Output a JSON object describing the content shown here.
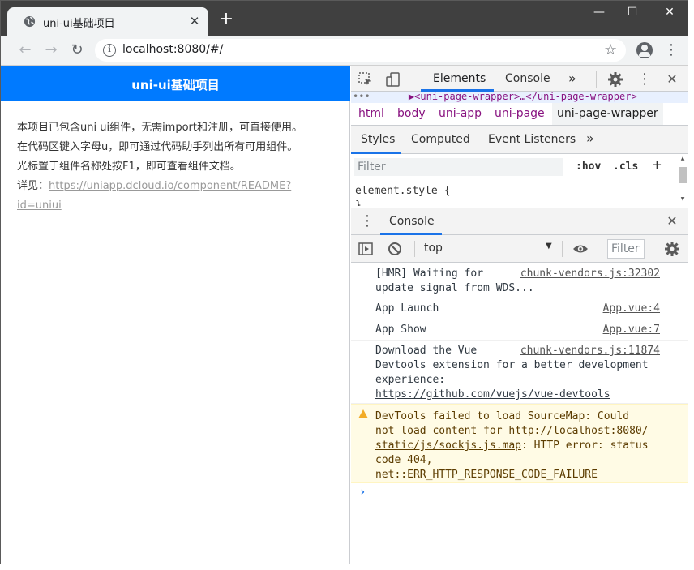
{
  "browser": {
    "tab_title": "uni-ui基础项目",
    "tab_close": "✕",
    "new_tab": "+",
    "url": "localhost:8080/#/",
    "window_controls": {
      "minimize": "—",
      "maximize": "☐",
      "close": "✕"
    },
    "nav": {
      "back": "←",
      "forward": "→",
      "reload": "↻",
      "star": "☆",
      "menu": "⋮"
    }
  },
  "app": {
    "navbar_title": "uni-ui基础项目",
    "lines": [
      "本项目已包含uni ui组件，无需import和注册，可直接使用。",
      "在代码区键入字母u，即可通过代码助手列出所有可用组件。",
      "光标置于组件名称处按F1，即可查看组件文档。"
    ],
    "detail_prefix": "详见：",
    "detail_link_line1": "https://uniapp.dcloud.io/component/README?",
    "detail_link_line2": "id=uniui"
  },
  "devtools": {
    "tabs": [
      "Elements",
      "Console"
    ],
    "more": "»",
    "close": "✕",
    "dom_line": "▶<uni-page-wrapper>…</uni-page-wrapper>",
    "breadcrumbs": [
      "html",
      "body",
      "uni-app",
      "uni-page",
      "uni-page-wrapper"
    ],
    "style_tabs": [
      "Styles",
      "Computed",
      "Event Listeners",
      "»"
    ],
    "filter_placeholder": "Filter",
    "hov": ":hov",
    "cls": ".cls",
    "plus": "+",
    "element_style": "element.style {",
    "element_brace": "}",
    "drawer_tab": "Console",
    "context": "top",
    "console_filter": "Filter",
    "messages": [
      {
        "text": "[HMR] Waiting for\nupdate signal from WDS...",
        "source": "chunk-vendors.js:32302",
        "level": "log"
      },
      {
        "text": "App Launch",
        "source": "App.vue:4",
        "level": "log"
      },
      {
        "text": "App Show",
        "source": "App.vue:7",
        "level": "log"
      },
      {
        "text": "Download the Vue\nDevtools extension for a better development\nexperience:",
        "link": "https://github.com/vuejs/vue-devtools",
        "source": "chunk-vendors.js:11874",
        "level": "log"
      }
    ],
    "warning": {
      "line1": "DevTools failed to load SourceMap: Could",
      "line2_prefix": "not load content for ",
      "line2_link": "http://localhost:8080/",
      "line3_link": "static/js/sockjs.js.map",
      "line3_suffix": ": HTTP error: status",
      "line4": "code 404,",
      "line5": "net::ERR_HTTP_RESPONSE_CODE_FAILURE"
    },
    "prompt": "›"
  },
  "colors": {
    "accent": "#007aff",
    "devtools_blue": "#1a73e8",
    "warning_bg": "#fffbe5"
  }
}
